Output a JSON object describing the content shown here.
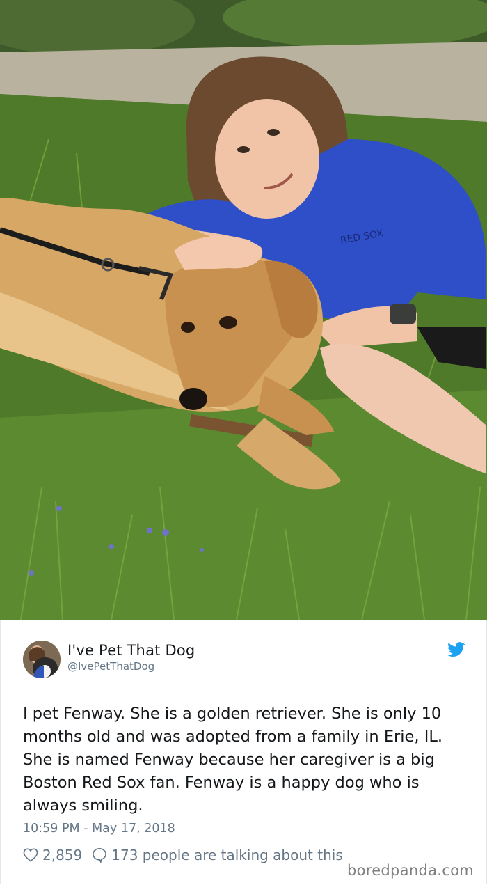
{
  "photo": {
    "alt_subject": "girl-with-golden-retriever-photo",
    "shirt_text": "RED SOX"
  },
  "tweet": {
    "display_name": "I've Pet That Dog",
    "handle": "@IvePetThatDog",
    "text": "I pet Fenway. She is a golden retriever. She is only 10 months old and was adopted from a family in Erie, IL. She is named Fenway because her caregiver is a big Boston Red Sox fan. Fenway is a happy dog who is always smiling.",
    "timestamp": "10:59 PM - May 17, 2018",
    "like_count": "2,859",
    "reply_text": "173 people are talking about this"
  },
  "icons": {
    "brand": "twitter-bird-icon",
    "like": "heart-icon",
    "reply": "speech-bubble-icon"
  },
  "watermark": "boredpanda.com",
  "colors": {
    "twitter_blue": "#1da1f2",
    "secondary_text": "#657786",
    "primary_text": "#14171a"
  }
}
